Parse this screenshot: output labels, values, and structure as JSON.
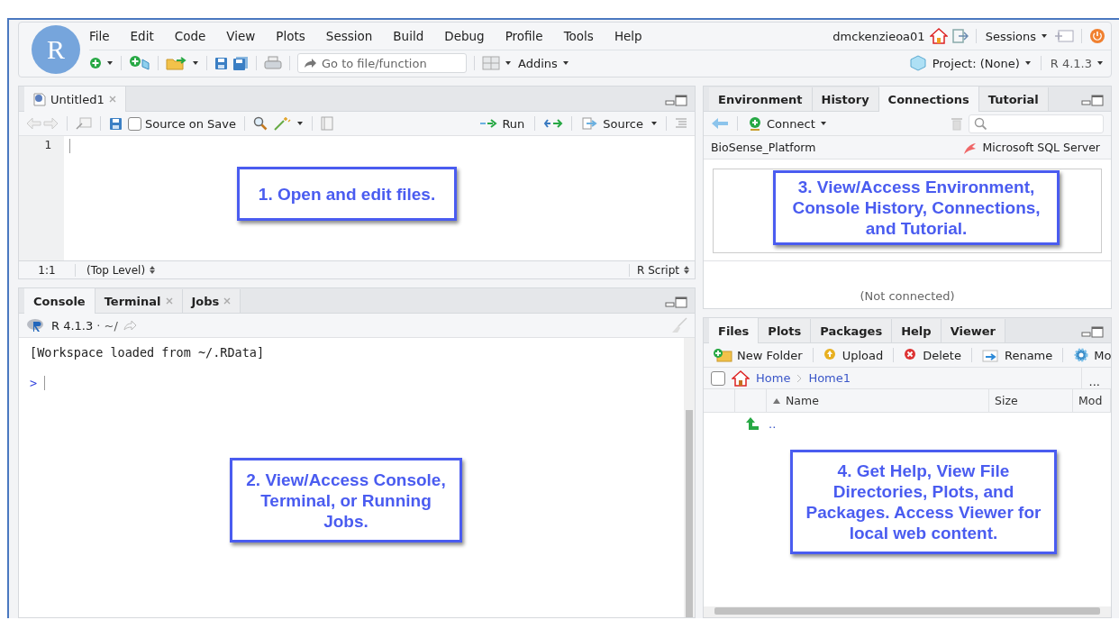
{
  "header": {
    "logo_letter": "R",
    "menu": [
      "File",
      "Edit",
      "Code",
      "View",
      "Plots",
      "Session",
      "Build",
      "Debug",
      "Profile",
      "Tools",
      "Help"
    ],
    "user": "dmckenzieoa01",
    "sessions": "Sessions",
    "go_to_file": {
      "placeholder": "Go to file/function"
    },
    "addins": "Addins",
    "project": "Project: (None)",
    "r_version": "R 4.1.3"
  },
  "source_pane": {
    "tabs": [
      {
        "label": "Untitled1",
        "selected": true
      }
    ],
    "source_on_save": {
      "label": "Source on Save",
      "checked": false
    },
    "run": "Run",
    "source": "Source",
    "line_numbers": [
      "1"
    ],
    "status": {
      "position": "1:1",
      "scope": "(Top Level)",
      "file_type": "R Script"
    }
  },
  "console_pane": {
    "tabs": [
      {
        "label": "Console",
        "selected": true,
        "closable": false
      },
      {
        "label": "Terminal",
        "selected": false,
        "closable": true
      },
      {
        "label": "Jobs",
        "selected": false,
        "closable": true
      }
    ],
    "version": "R 4.1.3",
    "path": "· ~/",
    "lines": [
      {
        "kind": "output",
        "text": "[Workspace loaded from ~/.RData]"
      },
      {
        "kind": "prompt",
        "text": ">"
      }
    ]
  },
  "environment_pane": {
    "tabs": [
      {
        "label": "Environment",
        "selected": false
      },
      {
        "label": "History",
        "selected": false
      },
      {
        "label": "Connections",
        "selected": true
      },
      {
        "label": "Tutorial",
        "selected": false
      }
    ],
    "connect": "Connect",
    "connections": [
      {
        "name": "BioSense_Platform",
        "driver": "Microsoft SQL Server"
      }
    ],
    "status": "(Not connected)"
  },
  "files_pane": {
    "tabs": [
      {
        "label": "Files",
        "selected": true
      },
      {
        "label": "Plots",
        "selected": false
      },
      {
        "label": "Packages",
        "selected": false
      },
      {
        "label": "Help",
        "selected": false
      },
      {
        "label": "Viewer",
        "selected": false
      }
    ],
    "toolbar": [
      {
        "kind": "new-folder",
        "label": "New Folder"
      },
      {
        "kind": "upload",
        "label": "Upload"
      },
      {
        "kind": "delete",
        "label": "Delete"
      },
      {
        "kind": "rename",
        "label": "Rename"
      },
      {
        "kind": "more",
        "label": "Mo"
      }
    ],
    "select_all": {
      "checked": false
    },
    "breadcrumb": [
      "Home",
      "Home1"
    ],
    "more": "...",
    "columns": [
      {
        "label": "Name",
        "sorted": true
      },
      {
        "label": "Size",
        "sorted": false
      },
      {
        "label": "Mod",
        "sorted": false
      }
    ],
    "rows": [
      {
        "name": ".."
      }
    ]
  },
  "callouts": [
    {
      "text": "1. Open and edit files."
    },
    {
      "text": "2. View/Access Console, Terminal, or Running Jobs."
    },
    {
      "text": "3. View/Access Environment, Console History, Connections, and Tutorial."
    },
    {
      "text": "4. Get Help, View File Directories, Plots, and Packages. Access Viewer for local web content."
    }
  ]
}
